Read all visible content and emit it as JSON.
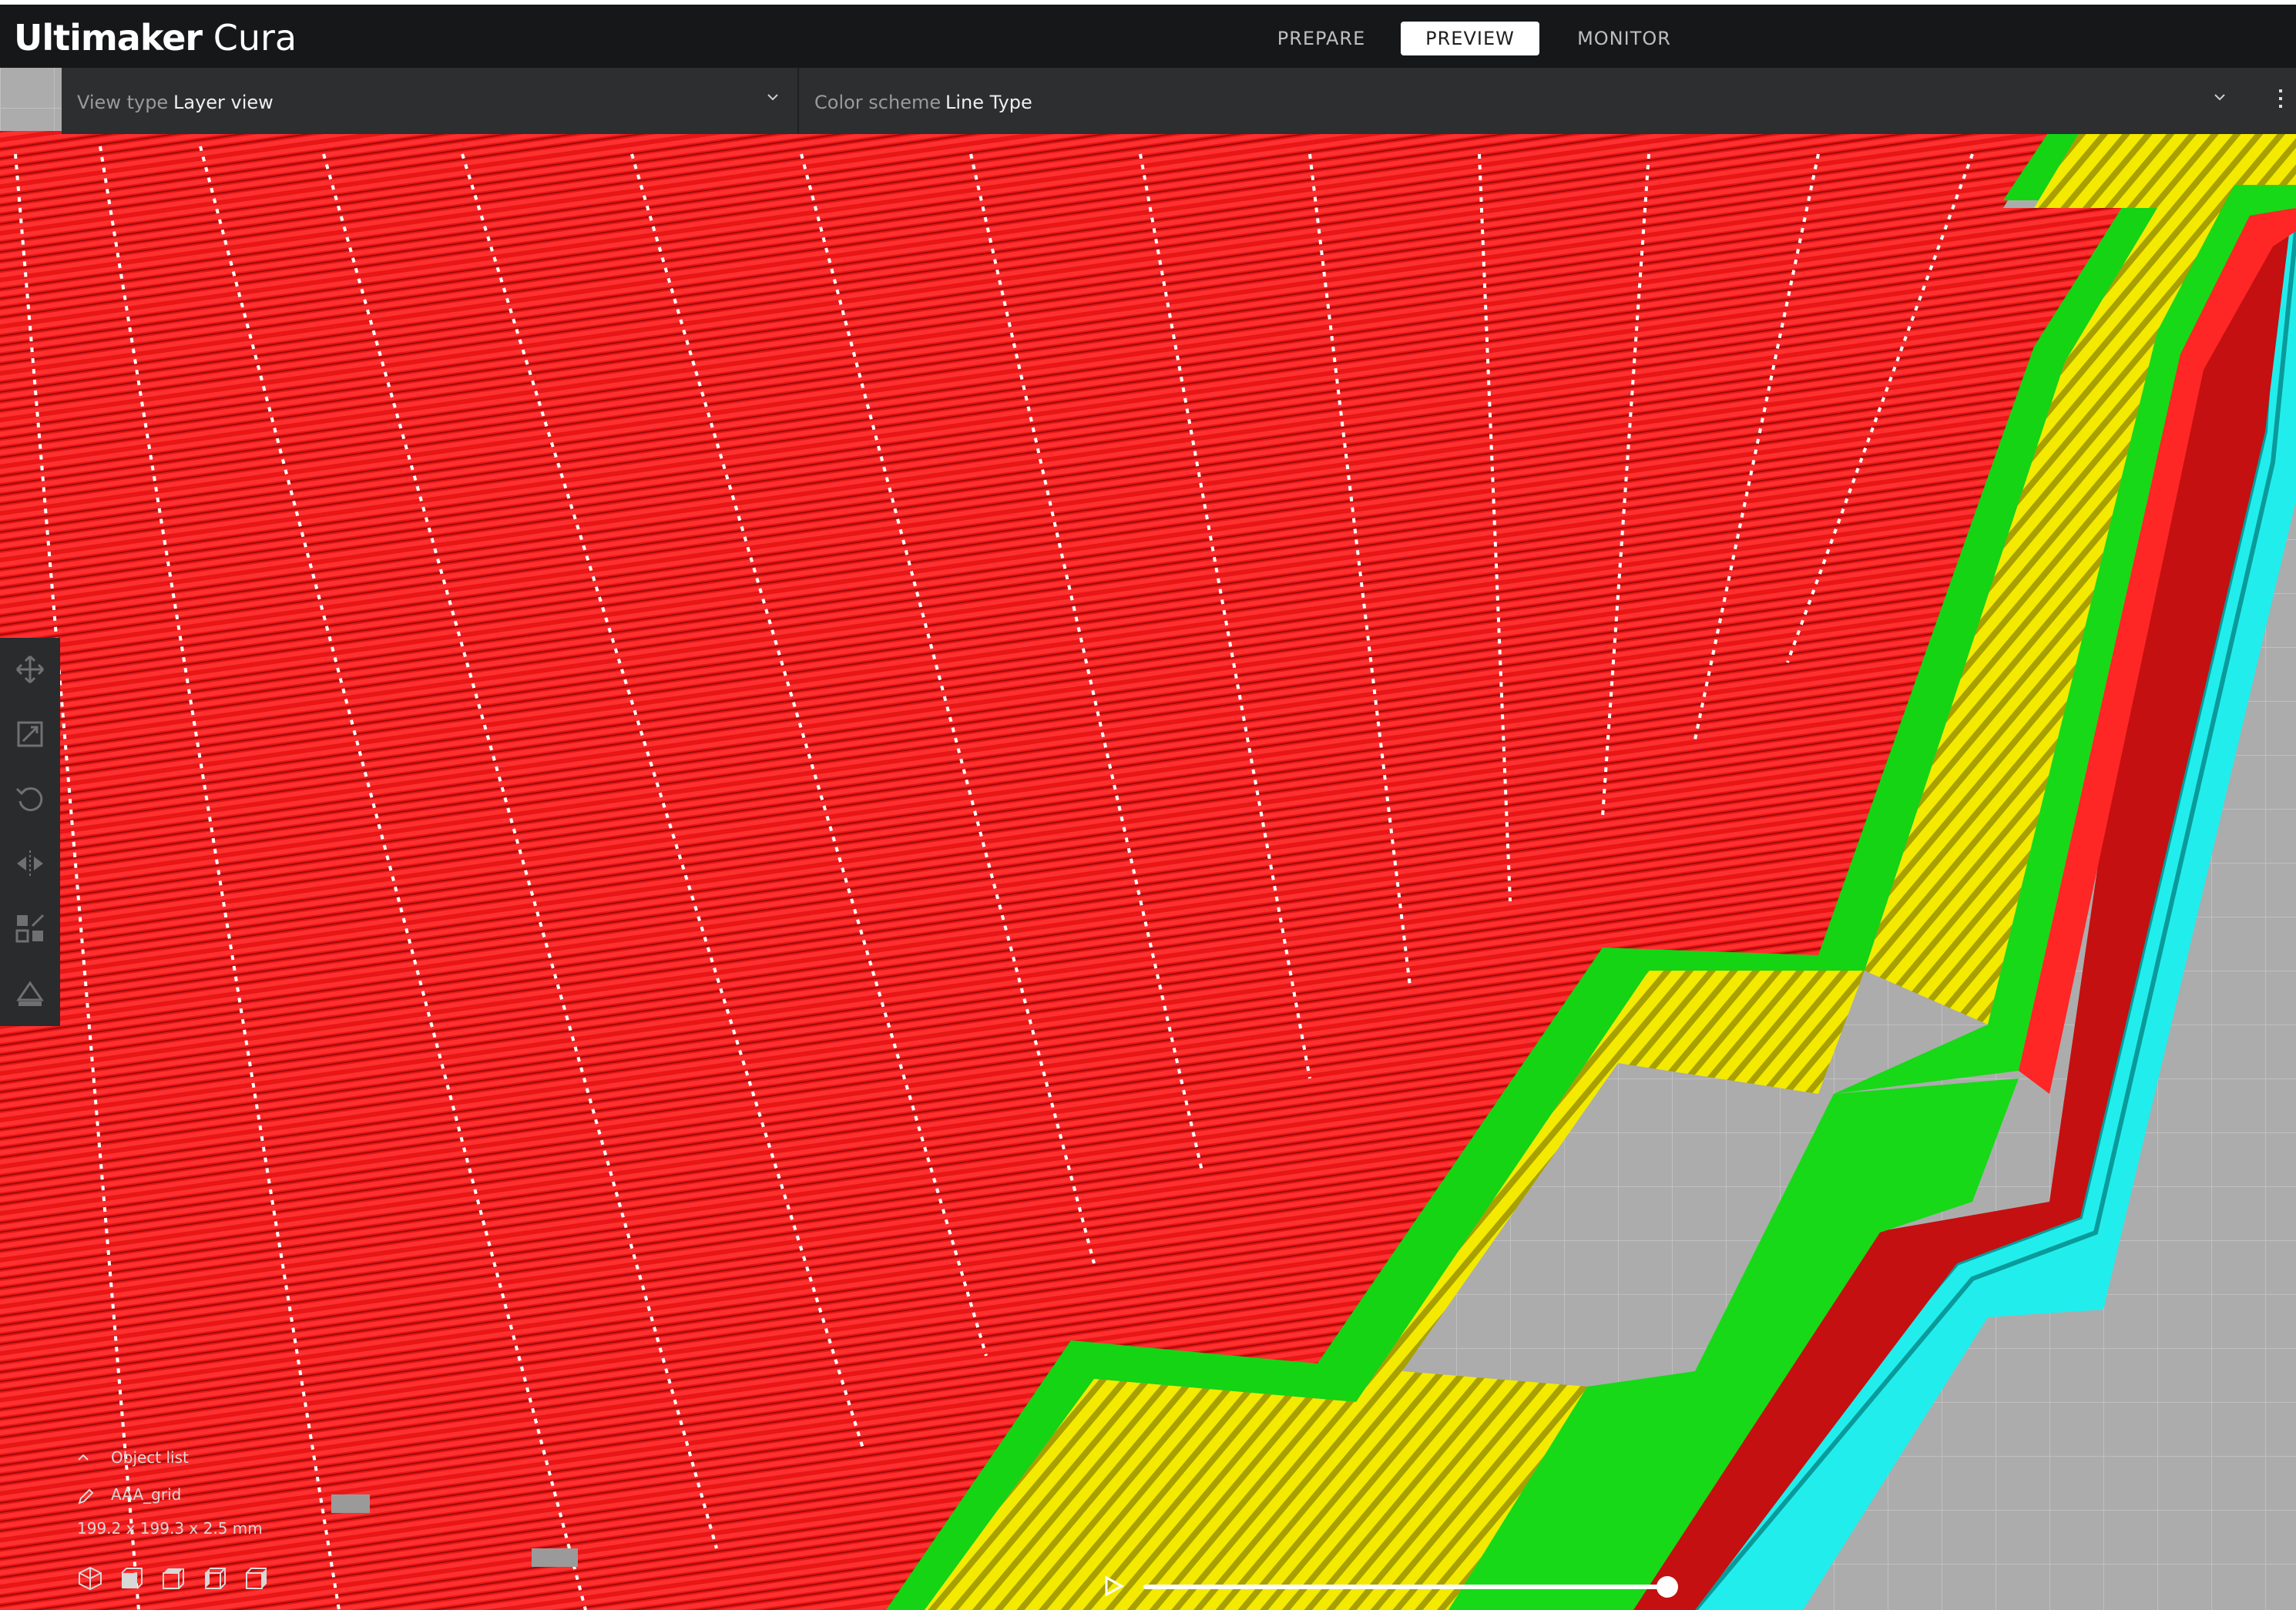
{
  "app": {
    "name_bold": "Ultimaker",
    "name_light": "Cura"
  },
  "stages": [
    {
      "label": "PREPARE",
      "active": false
    },
    {
      "label": "PREVIEW",
      "active": true
    },
    {
      "label": "MONITOR",
      "active": false
    }
  ],
  "view": {
    "view_type_label": "View type",
    "view_type_value": "Layer view",
    "color_scheme_label": "Color scheme",
    "color_scheme_value": "Line Type"
  },
  "tools": [
    "move-icon",
    "scale-icon",
    "rotate-icon",
    "mirror-icon",
    "per-model-settings-icon",
    "support-blocker-icon"
  ],
  "object_list": {
    "toggle_label": "Object list",
    "object_name": "AAA_grid",
    "dimensions": "199.2 x 199.3 x 2.5 mm"
  },
  "view_orientation_icons": [
    "3d-view-icon",
    "front-view-icon",
    "top-view-icon",
    "left-view-icon",
    "right-view-icon"
  ],
  "layer_slider": {
    "position": 1.0
  },
  "colors": {
    "infill": "#ff1a1a",
    "skin": "#fff200",
    "outer_wall": "#ff2020",
    "inner_wall": "#22e022",
    "skirt": "#1ff2f2",
    "build_plate": "#a8a8a8",
    "travel": "#ffffff"
  }
}
